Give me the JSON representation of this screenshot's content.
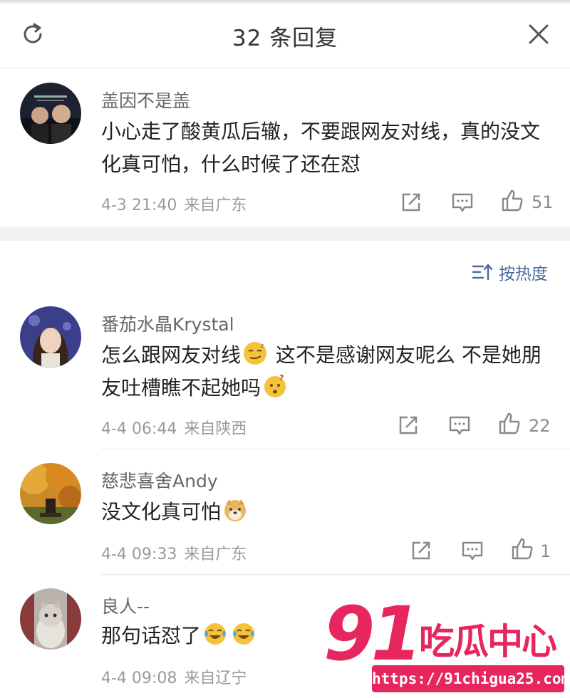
{
  "header": {
    "title": "32 条回复",
    "left_icon": "refresh-icon",
    "right_icon": "close-icon"
  },
  "main_comment": {
    "username": "盖因不是盖",
    "content": "小心走了酸黄瓜后辙，不要跟网友对线，真的没文化真可怕，什么时候了还在怼",
    "time": "4-3 21:40",
    "location": "来自广东",
    "likes": "51"
  },
  "sort": {
    "icon": "sort-icon",
    "label": "按热度"
  },
  "replies": [
    {
      "username": "番茄水晶Krystal",
      "content_part1": "怎么跟网友对线",
      "content_part2": " 这不是感谢网友呢么 不是她朋友吐槽瞧不起她吗",
      "emoji1": "smirk-emoji",
      "emoji2": "thinking-emoji",
      "time": "4-4 06:44",
      "location": "来自陕西",
      "likes": "22"
    },
    {
      "username": "慈悲喜舍Andy",
      "content": "没文化真可怕",
      "emoji": "doge-emoji",
      "time": "4-4 09:33",
      "location": "来自广东",
      "likes": "1"
    },
    {
      "username": "良人--",
      "content": "那句话怼了",
      "emoji": "laugh-cry-emoji",
      "time": "4-4 09:08",
      "location": "来自辽宁"
    }
  ],
  "watermark": {
    "number": "91",
    "text": "吃瓜中心",
    "url": "https://91chigua25.com"
  },
  "colors": {
    "accent_blue": "#4a6a9c",
    "watermark_pink": "#e8265e",
    "meta_gray": "#9a9a9a"
  }
}
